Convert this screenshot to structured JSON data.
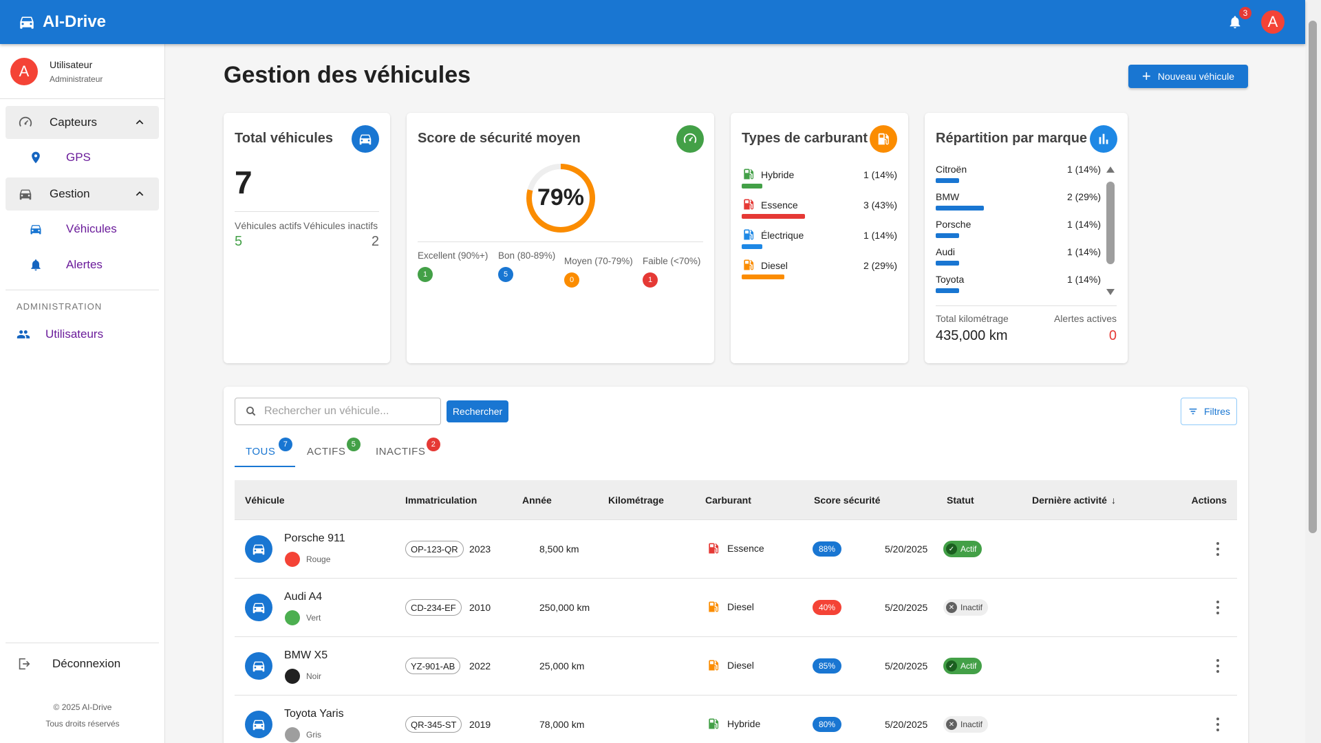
{
  "app": {
    "title": "AI-Drive",
    "notifications": "3",
    "avatar": "A"
  },
  "sidebar": {
    "user_initial": "A",
    "user_name": "Utilisateur",
    "user_role": "Administrateur",
    "groups": [
      {
        "label": "Capteurs",
        "items": [
          {
            "label": "GPS",
            "icon": "location-pin-icon"
          }
        ]
      },
      {
        "label": "Gestion",
        "items": [
          {
            "label": "Véhicules",
            "icon": "car-icon"
          },
          {
            "label": "Alertes",
            "icon": "bell-icon"
          }
        ]
      }
    ],
    "admin_title": "ADMINISTRATION",
    "admin_items": [
      {
        "label": "Utilisateurs",
        "icon": "people-icon"
      }
    ],
    "logout": "Déconnexion",
    "footer_line1": "© 2025 AI-Drive",
    "footer_line2": "Tous droits réservés"
  },
  "page": {
    "title": "Gestion des véhicules",
    "new_button": "Nouveau véhicule"
  },
  "stats": {
    "total": {
      "title": "Total véhicules",
      "value": "7",
      "active_label": "Véhicules actifs",
      "active_value": "5",
      "inactive_label": "Véhicules inactifs",
      "inactive_value": "2"
    },
    "safety": {
      "title": "Score de sécurité moyen",
      "value": "79%",
      "percent": 79,
      "categories": [
        {
          "label": "Excellent (90%+)",
          "count": "1",
          "color": "#43a047"
        },
        {
          "label": "Bon (80-89%)",
          "count": "5",
          "color": "#1976d2"
        },
        {
          "label": "Moyen (70-79%)",
          "count": "0",
          "color": "#fb8c00"
        },
        {
          "label": "Faible (<70%)",
          "count": "1",
          "color": "#e53935"
        }
      ]
    },
    "fuel": {
      "title": "Types de carburant",
      "items": [
        {
          "label": "Hybride",
          "count": "1 (14%)",
          "share": 0.14,
          "color": "#43a047"
        },
        {
          "label": "Essence",
          "count": "3 (43%)",
          "share": 0.43,
          "color": "#e53935"
        },
        {
          "label": "Électrique",
          "count": "1 (14%)",
          "share": 0.14,
          "color": "#1e88e5"
        },
        {
          "label": "Diesel",
          "count": "2 (29%)",
          "share": 0.29,
          "color": "#fb8c00"
        }
      ]
    },
    "brands": {
      "title": "Répartition par marque",
      "items": [
        {
          "label": "Citroën",
          "count": "1 (14%)",
          "share": 0.14
        },
        {
          "label": "BMW",
          "count": "2 (29%)",
          "share": 0.29
        },
        {
          "label": "Porsche",
          "count": "1 (14%)",
          "share": 0.14
        },
        {
          "label": "Audi",
          "count": "1 (14%)",
          "share": 0.14
        },
        {
          "label": "Toyota",
          "count": "1 (14%)",
          "share": 0.14
        }
      ],
      "km_label": "Total kilométrage",
      "km_value": "435,000 km",
      "alerts_label": "Alertes actives",
      "alerts_value": "0"
    }
  },
  "table": {
    "search_placeholder": "Rechercher un véhicule...",
    "search_button": "Rechercher",
    "filters_button": "Filtres",
    "tabs": [
      {
        "label": "TOUS",
        "count": "7",
        "color": "#1976d2"
      },
      {
        "label": "ACTIFS",
        "count": "5",
        "color": "#43a047"
      },
      {
        "label": "INACTIFS",
        "count": "2",
        "color": "#e53935"
      }
    ],
    "columns": [
      "Véhicule",
      "Immatriculation",
      "Année",
      "Kilométrage",
      "Carburant",
      "Score sécurité",
      "Statut",
      "Dernière activité",
      "Actions"
    ],
    "rows": [
      {
        "name": "Porsche 911",
        "color_name": "Rouge",
        "color": "#f44336",
        "plate": "OP-123-QR",
        "year": "2023",
        "km": "8,500 km",
        "fuel": "Essence",
        "fuel_color": "#e53935",
        "score": "88%",
        "score_color": "#1976d2",
        "status": "Actif",
        "status_active": true,
        "last": "5/20/2025"
      },
      {
        "name": "Audi A4",
        "color_name": "Vert",
        "color": "#4caf50",
        "plate": "CD-234-EF",
        "year": "2010",
        "km": "250,000 km",
        "fuel": "Diesel",
        "fuel_color": "#fb8c00",
        "score": "40%",
        "score_color": "#f44336",
        "status": "Inactif",
        "status_active": false,
        "last": "5/20/2025"
      },
      {
        "name": "BMW X5",
        "color_name": "Noir",
        "color": "#212121",
        "plate": "YZ-901-AB",
        "year": "2022",
        "km": "25,000 km",
        "fuel": "Diesel",
        "fuel_color": "#fb8c00",
        "score": "85%",
        "score_color": "#1976d2",
        "status": "Actif",
        "status_active": true,
        "last": "5/20/2025"
      },
      {
        "name": "Toyota Yaris",
        "color_name": "Gris",
        "color": "#9e9e9e",
        "plate": "QR-345-ST",
        "year": "2019",
        "km": "78,000 km",
        "fuel": "Hybride",
        "fuel_color": "#43a047",
        "score": "80%",
        "score_color": "#1976d2",
        "status": "Inactif",
        "status_active": false,
        "last": "5/20/2025"
      }
    ]
  }
}
